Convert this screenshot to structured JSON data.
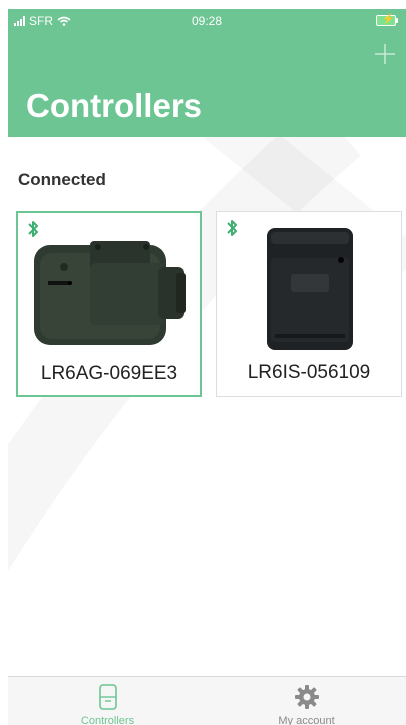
{
  "status_bar": {
    "carrier": "SFR",
    "time": "09:28"
  },
  "header": {
    "title": "Controllers"
  },
  "section": {
    "title": "Connected"
  },
  "controllers": [
    {
      "name": "LR6AG-069EE3",
      "selected": true
    },
    {
      "name": "LR6IS-056109",
      "selected": false
    }
  ],
  "tabbar": {
    "tabs": [
      {
        "label": "Controllers",
        "active": true
      },
      {
        "label": "My account",
        "active": false
      }
    ]
  },
  "colors": {
    "accent": "#6cc592",
    "bluetooth": "#3fae73"
  }
}
